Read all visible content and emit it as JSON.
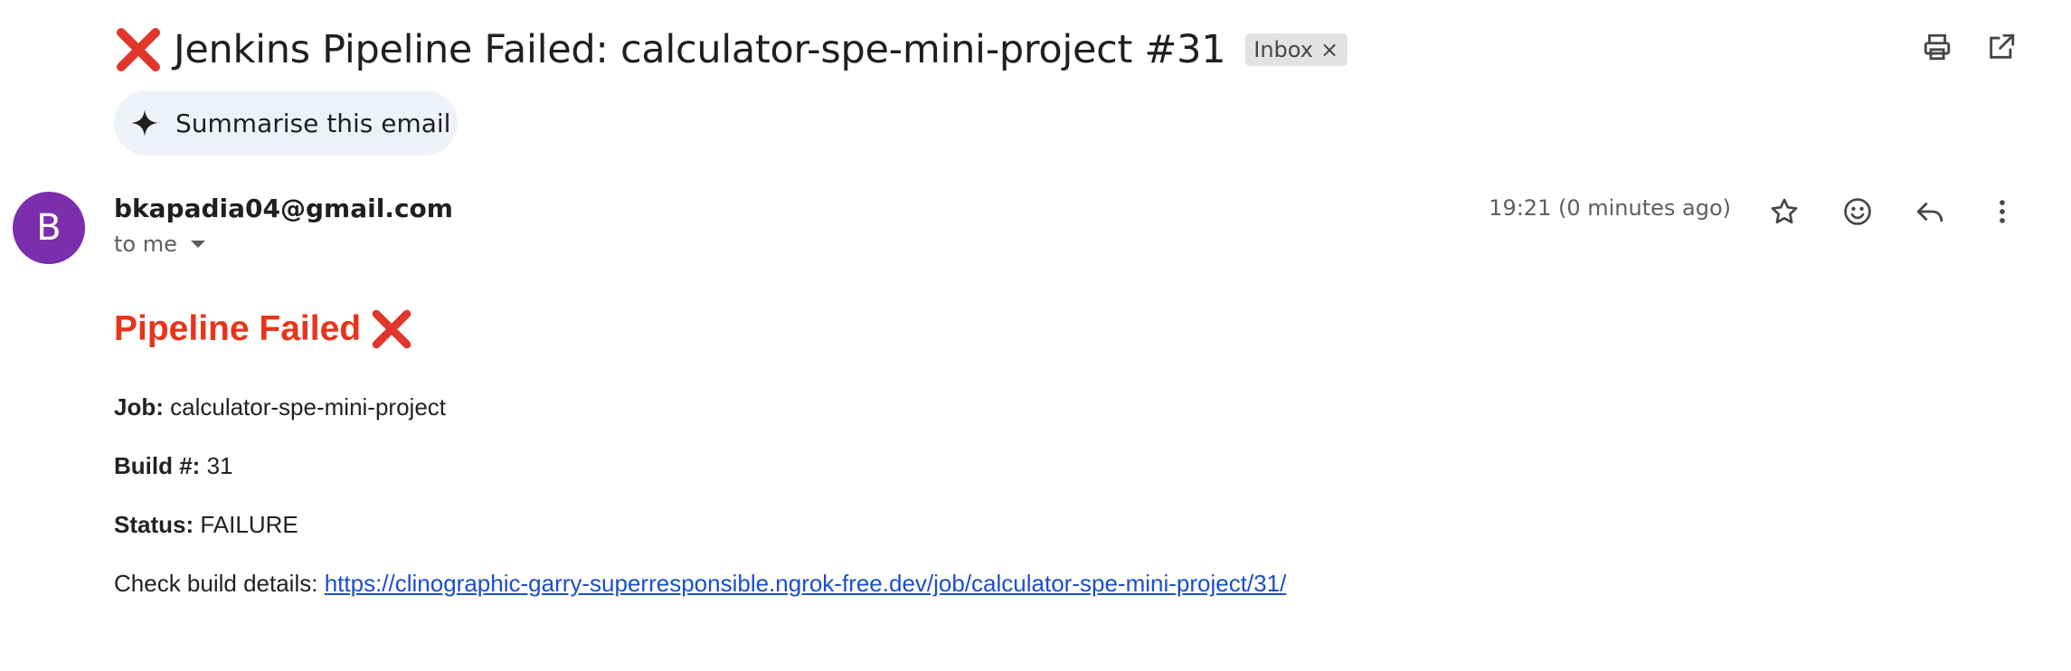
{
  "email": {
    "subject": "Jenkins Pipeline Failed: calculator-spe-mini-project #31",
    "label": "Inbox",
    "label_remove": "×",
    "summarise_label": "Summarise this email",
    "sender_initial": "B",
    "sender": "bkapadia04@gmail.com",
    "recipient": "to me",
    "timestamp": "19:21 (0 minutes ago)"
  },
  "body": {
    "heading": "Pipeline Failed",
    "job_label": "Job:",
    "job_value": "calculator-spe-mini-project",
    "build_label": "Build #:",
    "build_value": "31",
    "status_label": "Status:",
    "status_value": "FAILURE",
    "details_label": "Check build details:",
    "details_link": "https://clinographic-garry-superresponsible.ngrok-free.dev/job/calculator-spe-mini-project/31/"
  },
  "icons": {
    "subject_status": "cross-mark-icon",
    "heading_status": "cross-mark-icon",
    "print": "print-icon",
    "open_new_window": "open-in-new-window-icon",
    "summarise": "sparkle-icon",
    "recipient_details": "dropdown-arrow-icon",
    "star": "star-icon",
    "react": "emoji-icon",
    "reply": "reply-icon",
    "more": "more-vert-icon"
  },
  "colors": {
    "avatar": "#7b2fad",
    "heading": "#e8341c",
    "link": "#1a4fc7",
    "cross_mark": "#e0362b"
  }
}
